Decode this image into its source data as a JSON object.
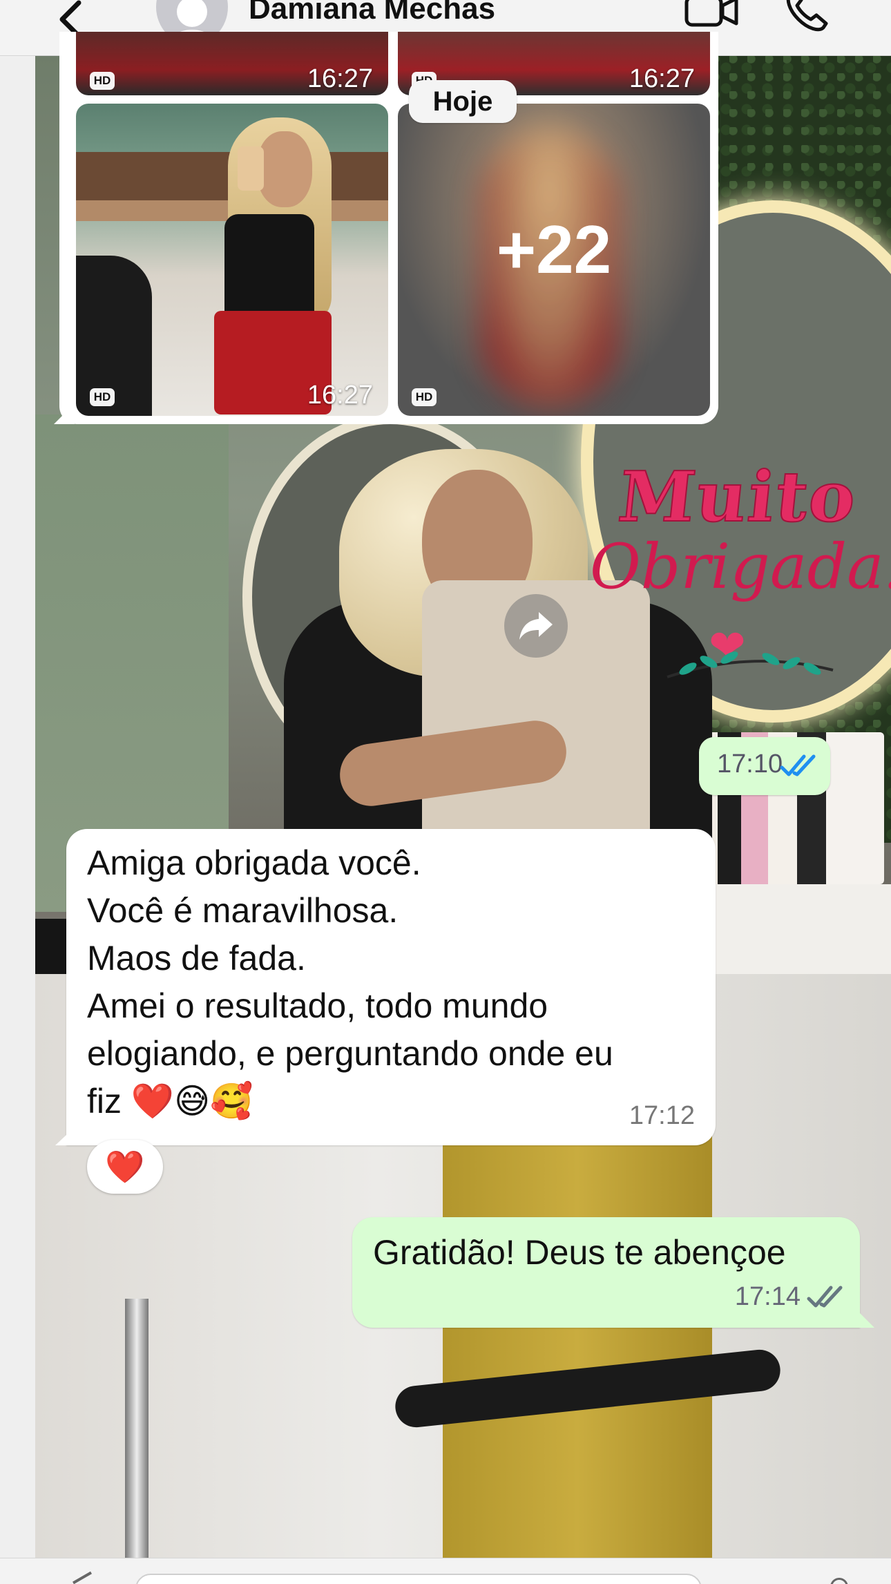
{
  "header": {
    "contact_name": "Damiana Mechas",
    "icons": [
      "chevron-left-icon",
      "avatar-icon",
      "video-call-icon",
      "phone-icon"
    ]
  },
  "media_group": {
    "tiles": [
      {
        "hd": "HD",
        "time": "16:27"
      },
      {
        "hd": "HD",
        "time": "16:27"
      },
      {
        "hd": "HD",
        "time": "16:27"
      },
      {
        "hd": "HD",
        "more": "+22"
      }
    ]
  },
  "date_separator": "Hoje",
  "sticker": {
    "line1": "Muito",
    "line2": "Obrigada!",
    "time": "17:10",
    "status_color": "#1f8ff0"
  },
  "incoming_message": {
    "lines": [
      "Amiga obrigada você.",
      "Você é maravilhosa.",
      "Maos de fada.",
      "Amei o resultado, todo mundo",
      "elogiando, e perguntando onde eu",
      "fiz ❤️😅🥰"
    ],
    "time": "17:12",
    "reaction": "❤️"
  },
  "outgoing_message": {
    "text": "Gratidão! Deus te abençoe",
    "time": "17:14",
    "status_color": "#667781"
  },
  "colors": {
    "outgoing_bubble": "#d9fdd3",
    "incoming_bubble": "#ffffff",
    "header_bg": "#f3f3f3"
  }
}
